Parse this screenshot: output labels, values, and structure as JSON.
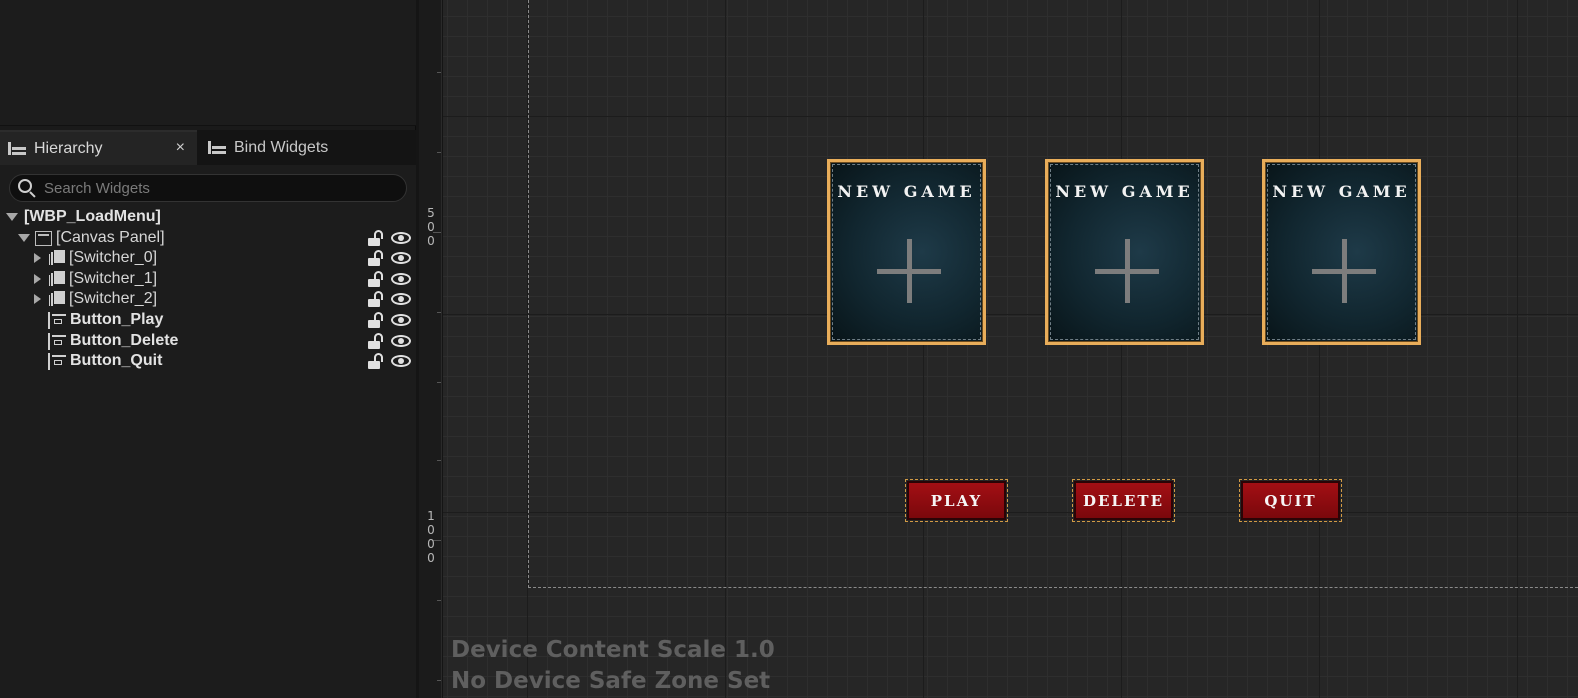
{
  "hierarchy_panel": {
    "tabs": [
      {
        "label": "Hierarchy"
      },
      {
        "label": "Bind Widgets"
      }
    ],
    "close_glyph": "×",
    "search": {
      "placeholder": "Search Widgets",
      "value": ""
    },
    "tree": [
      {
        "label": "[WBP_LoadMenu]",
        "expanded": true
      },
      {
        "label": "[Canvas Panel]",
        "expanded": true,
        "icon": "canvas-panel-icon"
      },
      {
        "label": "[Switcher_0]",
        "expanded": false,
        "icon": "widget-switcher-icon"
      },
      {
        "label": "[Switcher_1]",
        "expanded": false,
        "icon": "widget-switcher-icon"
      },
      {
        "label": "[Switcher_2]",
        "expanded": false,
        "icon": "widget-switcher-icon"
      },
      {
        "label": "Button_Play",
        "icon": "button-widget-icon"
      },
      {
        "label": "Button_Delete",
        "icon": "button-widget-icon"
      },
      {
        "label": "Button_Quit",
        "icon": "button-widget-icon"
      }
    ]
  },
  "ruler": {
    "labels": [
      "5\n0\n0",
      "1\n0\n0\n0"
    ]
  },
  "designer": {
    "slots": [
      {
        "title": "NEW GAME"
      },
      {
        "title": "NEW GAME"
      },
      {
        "title": "NEW GAME"
      }
    ],
    "buttons": [
      {
        "label": "PLAY"
      },
      {
        "label": "DELETE"
      },
      {
        "label": "QUIT"
      }
    ],
    "overlay": {
      "line1": "Device Content Scale 1.0",
      "line2": "No Device Safe Zone Set"
    },
    "colors": {
      "slot_border": "#e8ad5a",
      "button_fill": "#a30f14",
      "canvas_bg": "#262626"
    }
  }
}
